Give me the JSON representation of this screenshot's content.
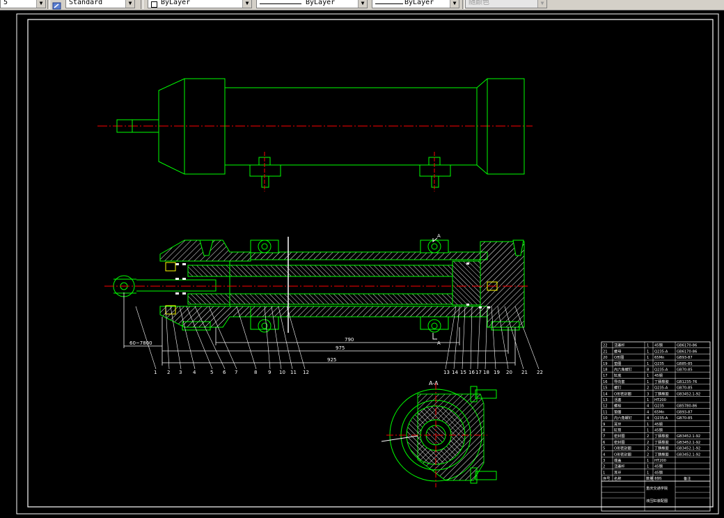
{
  "toolbar": {
    "leading_fragment": "5",
    "textstyle_value": "Standard",
    "layer_value": "ByLayer",
    "linetype_value": "ByLayer",
    "lineweight_value": "ByLayer",
    "plotstyle_value": "随颜色"
  },
  "drawing": {
    "section_label": "A-A",
    "cut_marker_top": "A",
    "cut_marker_bottom": "A",
    "dimensions": [
      "790",
      "975",
      "925",
      "60~7800"
    ],
    "leader_numbers": [
      "1",
      "2",
      "3",
      "4",
      "5",
      "6",
      "7",
      "8",
      "9",
      "10",
      "11",
      "12",
      "13",
      "14",
      "15",
      "16",
      "17",
      "18",
      "19",
      "20",
      "21",
      "22"
    ]
  },
  "title_block": {
    "parts": [
      {
        "no": "22",
        "name": "活塞杆",
        "qty": "1",
        "material": "45钢",
        "std": "GB6170-86"
      },
      {
        "no": "21",
        "name": "螺母",
        "qty": "1",
        "material": "Q235-A",
        "std": "GB6170-86"
      },
      {
        "no": "20",
        "name": "O形圈",
        "qty": "1",
        "material": "65Mn",
        "std": "GB93-87"
      },
      {
        "no": "19",
        "name": "垫圈",
        "qty": "1",
        "material": "Q235",
        "std": "GB85-85"
      },
      {
        "no": "18",
        "name": "内六角螺钉",
        "qty": "8",
        "material": "Q235-A",
        "std": "GB70-85"
      },
      {
        "no": "17",
        "name": "缸底",
        "qty": "1",
        "material": "45钢",
        "std": ""
      },
      {
        "no": "16",
        "name": "导向套",
        "qty": "1",
        "material": "丁腈橡胶",
        "std": "GB1235-76"
      },
      {
        "no": "15",
        "name": "螺钉",
        "qty": "2",
        "material": "Q235-A",
        "std": "GB70-85"
      },
      {
        "no": "14",
        "name": "O形密封圈",
        "qty": "3",
        "material": "丁腈橡胶",
        "std": "GB3452.1-92"
      },
      {
        "no": "13",
        "name": "活塞",
        "qty": "1",
        "material": "HT200",
        "std": ""
      },
      {
        "no": "12",
        "name": "螺栓",
        "qty": "4",
        "material": "Q235",
        "std": "GB5780-86"
      },
      {
        "no": "11",
        "name": "垫圈",
        "qty": "4",
        "material": "65Mn",
        "std": "GB93-87"
      },
      {
        "no": "10",
        "name": "内六角螺钉",
        "qty": "4",
        "material": "Q235-A",
        "std": "GB70-85"
      },
      {
        "no": "9",
        "name": "耳环",
        "qty": "1",
        "material": "45钢",
        "std": ""
      },
      {
        "no": "8",
        "name": "缸筒",
        "qty": "1",
        "material": "45钢",
        "std": ""
      },
      {
        "no": "7",
        "name": "密封圈",
        "qty": "2",
        "material": "丁腈橡胶",
        "std": "GB3452.1-92"
      },
      {
        "no": "6",
        "name": "密封圈",
        "qty": "2",
        "material": "丁腈橡胶",
        "std": "GB3452.1-92"
      },
      {
        "no": "5",
        "name": "O形密封圈",
        "qty": "2",
        "material": "丁腈橡胶",
        "std": "GB3452.1-92"
      },
      {
        "no": "4",
        "name": "O形密封圈",
        "qty": "2",
        "material": "丁腈橡胶",
        "std": "GB3452.1-92"
      },
      {
        "no": "3",
        "name": "端盖",
        "qty": "1",
        "material": "HT200",
        "std": ""
      },
      {
        "no": "2",
        "name": "活塞杆",
        "qty": "1",
        "material": "45钢",
        "std": ""
      },
      {
        "no": "1",
        "name": "耳环",
        "qty": "1",
        "material": "45钢",
        "std": ""
      }
    ],
    "header": {
      "no": "序号",
      "name": "名称",
      "qty": "数量",
      "material": "材料",
      "std": "备注"
    },
    "school": "重庆交通学院",
    "title": "液压缸装配图"
  },
  "colors": {
    "green": "#00ff00",
    "white": "#ffffff",
    "red": "#ff0000",
    "yellow": "#ffff00",
    "cyan": "#00ffff"
  }
}
